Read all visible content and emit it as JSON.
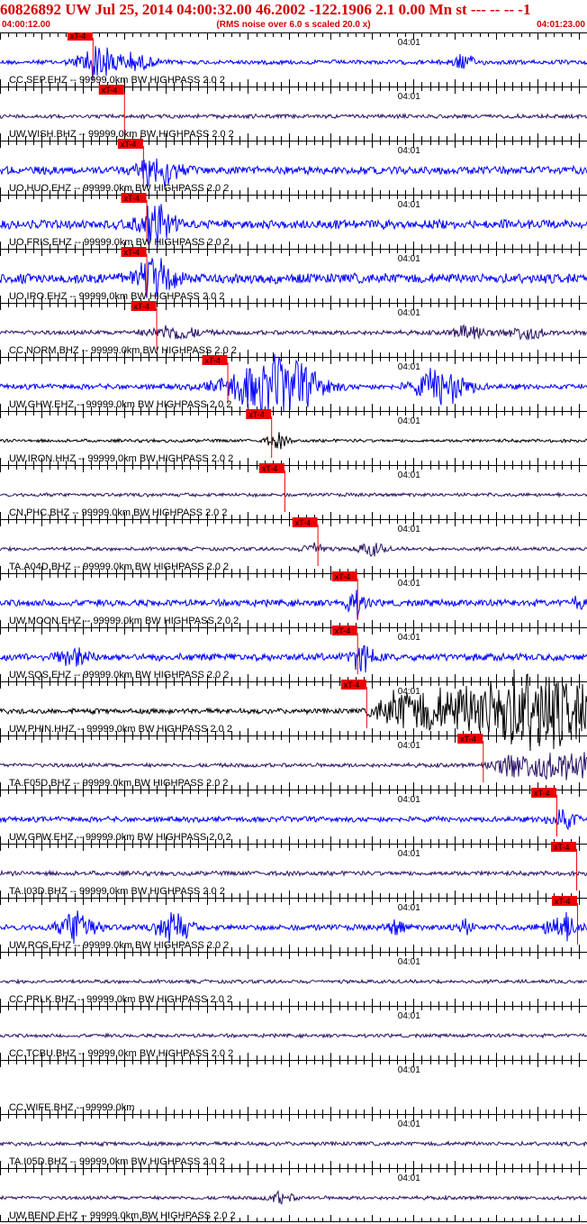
{
  "header": {
    "title": "60826892 UW Jul 25, 2014 04:00:32.00   46.2002 -122.1906  2.1 0.00 Mn st --- -- --  -1",
    "start_time": "04:00:12.00",
    "subtitle": "(RMS noise over 6.0 s scaled 20.0 x)",
    "end_time": "04:01:23.00"
  },
  "colors": {
    "header_text": "#d40000",
    "pick_box": "#ee0000",
    "pick_line": "#ee0000",
    "axis": "#000000"
  },
  "chart_data": {
    "type": "line",
    "title": "60826892 UW Jul 25, 2014 04:00:32.00   46.2002 -122.1906  2.1 0.00 Mn st --- -- --  -1",
    "x_range_time": [
      "04:00:12.00",
      "04:01:23.00"
    ],
    "x_range_seconds": [
      0,
      71
    ],
    "x_tick_interval_s": 1,
    "x_major_tick_label": "04:01",
    "x_major_tick_s": 48,
    "pick_label": "xT-4",
    "series": [
      {
        "label": "CC.SEP.EHZ -- 99999.0km BW  HIGHPASS  2.0  2",
        "color": "#0000ff",
        "pick_s": 11.2,
        "noise": 0.1,
        "events": [
          [
            11.5,
            0.75,
            2.0
          ],
          [
            15.5,
            0.35,
            3.0
          ],
          [
            56.0,
            0.28,
            1.5
          ]
        ]
      },
      {
        "label": "UW.WISH.BHZ -- 99999.0km BW  HIGHPASS  2.0  2",
        "color": "#2c1566",
        "pick_s": 15.0,
        "noise": 0.09,
        "events": []
      },
      {
        "label": "UO.HUO.EHZ -- 99999.0km BW  HIGHPASS  2.0  2",
        "color": "#0000ff",
        "pick_s": 17.3,
        "noise": 0.18,
        "events": [
          [
            19.0,
            0.95,
            2.0
          ]
        ]
      },
      {
        "label": "UO.FRIS.EHZ -- 99999.0km BW  HIGHPASS  2.0  2",
        "color": "#0000ff",
        "pick_s": 17.7,
        "noise": 0.2,
        "events": [
          [
            19.0,
            0.9,
            2.0
          ]
        ]
      },
      {
        "label": "UO.IRO.EHZ -- 99999.0km BW  HIGHPASS  2.0  2",
        "color": "#0000ff",
        "pick_s": 17.7,
        "noise": 0.22,
        "events": [
          [
            18.8,
            0.85,
            2.2
          ]
        ]
      },
      {
        "label": "CC.NORM.BHZ -- 99999.0km BW  HIGHPASS  2.0  2",
        "color": "#2c1566",
        "pick_s": 18.9,
        "noise": 0.1,
        "events": [
          [
            21.0,
            0.3,
            3.0
          ],
          [
            57.0,
            0.3,
            2.0
          ],
          [
            63.5,
            0.3,
            2.0
          ]
        ]
      },
      {
        "label": "UW.GHW.EHZ -- 99999.0km BW  HIGHPASS  2.0  2",
        "color": "#0000ff",
        "pick_s": 27.5,
        "noise": 0.12,
        "events": [
          [
            31.5,
            0.95,
            4.5
          ],
          [
            36.0,
            0.7,
            3.5
          ],
          [
            53.5,
            0.8,
            3.0
          ]
        ]
      },
      {
        "label": "UW.IRON.HHZ -- 99999.0km BW  HIGHPASS  2.0  2",
        "color": "#000000",
        "pick_s": 32.8,
        "noise": 0.07,
        "events": [
          [
            33.5,
            0.35,
            1.2
          ]
        ]
      },
      {
        "label": "CN.PHC.BHZ -- 99999.0km BW  HIGHPASS  2.0  2",
        "color": "#2c1566",
        "pick_s": 34.4,
        "noise": 0.08,
        "events": []
      },
      {
        "label": "TA.A04D.BHZ -- 99999.0km BW  HIGHPASS  2.0  2",
        "color": "#2c1566",
        "pick_s": 38.4,
        "noise": 0.08,
        "events": [
          [
            38.0,
            0.3,
            1.2
          ],
          [
            45.0,
            0.3,
            1.5
          ]
        ]
      },
      {
        "label": "UW.MOON.EHZ -- 99999.0km BW  HIGHPASS  2.0  2",
        "color": "#0000ff",
        "pick_s": 43.2,
        "noise": 0.15,
        "events": [
          [
            43.0,
            0.55,
            1.2
          ],
          [
            70.0,
            0.3,
            0.6
          ]
        ]
      },
      {
        "label": "UW.SQS.EHZ -- 99999.0km BW  HIGHPASS  2.0  2",
        "color": "#0000ff",
        "pick_s": 43.2,
        "noise": 0.16,
        "events": [
          [
            9.0,
            0.35,
            2.0
          ],
          [
            43.8,
            0.5,
            1.5
          ]
        ]
      },
      {
        "label": "UW.PHIN.HHZ -- 99999.0km BW  HIGHPASS  2.0  2",
        "color": "#000000",
        "pick_s": 44.3,
        "noise": 0.12,
        "ramp": [
          44.0,
          0.85
        ],
        "events": [
          [
            64.0,
            0.95,
            6.0
          ]
        ]
      },
      {
        "label": "TA.F05D.BHZ -- 99999.0km BW  HIGHPASS  2.0  2",
        "color": "#2c1566",
        "pick_s": 58.4,
        "noise": 0.09,
        "ramp": [
          58.0,
          0.55
        ],
        "events": []
      },
      {
        "label": "UW.GPW.EHZ -- 99999.0km BW  HIGHPASS  2.0  2",
        "color": "#0000ff",
        "pick_s": 67.3,
        "noise": 0.12,
        "events": [
          [
            68.0,
            0.5,
            1.5
          ]
        ]
      },
      {
        "label": "TA.I03D.BHZ -- 99999.0km BW  HIGHPASS  2.0  2",
        "color": "#2c1566",
        "pick_s": 69.7,
        "noise": 0.1,
        "events": []
      },
      {
        "label": "UW.RCS.EHZ -- 99999.0km BW  HIGHPASS  2.0  2",
        "color": "#0000ff",
        "pick_s": 69.8,
        "noise": 0.13,
        "events": [
          [
            9.5,
            0.8,
            2.0
          ],
          [
            21.0,
            0.75,
            1.8
          ],
          [
            48.0,
            0.35,
            1.0
          ],
          [
            56.0,
            0.35,
            1.0
          ],
          [
            68.0,
            0.6,
            2.0
          ]
        ]
      },
      {
        "label": "CC.PRLK.BHZ -- 99999.0km BW  HIGHPASS  2.0  2",
        "color": "#2c1566",
        "pick_s": null,
        "noise": 0.08,
        "events": []
      },
      {
        "label": "CC.TCBU.BHZ -- 99999.0km BW  HIGHPASS  2.0  2",
        "color": "#2c1566",
        "pick_s": null,
        "noise": 0.08,
        "events": []
      },
      {
        "label": "CC.WIFE.BHZ -- 99999.0km",
        "color": "#2c1566",
        "pick_s": null,
        "noise": 0,
        "events": []
      },
      {
        "label": "TA.I05D.BHZ -- 99999.0km BW  HIGHPASS  2.0  2",
        "color": "#2c1566",
        "pick_s": null,
        "noise": 0.09,
        "events": []
      },
      {
        "label": "UW.BEND.EHZ -- 99999.0km BW  HIGHPASS  2.0  2",
        "color": "#2c1566",
        "pick_s": null,
        "noise": 0.08,
        "events": [
          [
            34.0,
            0.25,
            1.5
          ]
        ]
      }
    ]
  }
}
